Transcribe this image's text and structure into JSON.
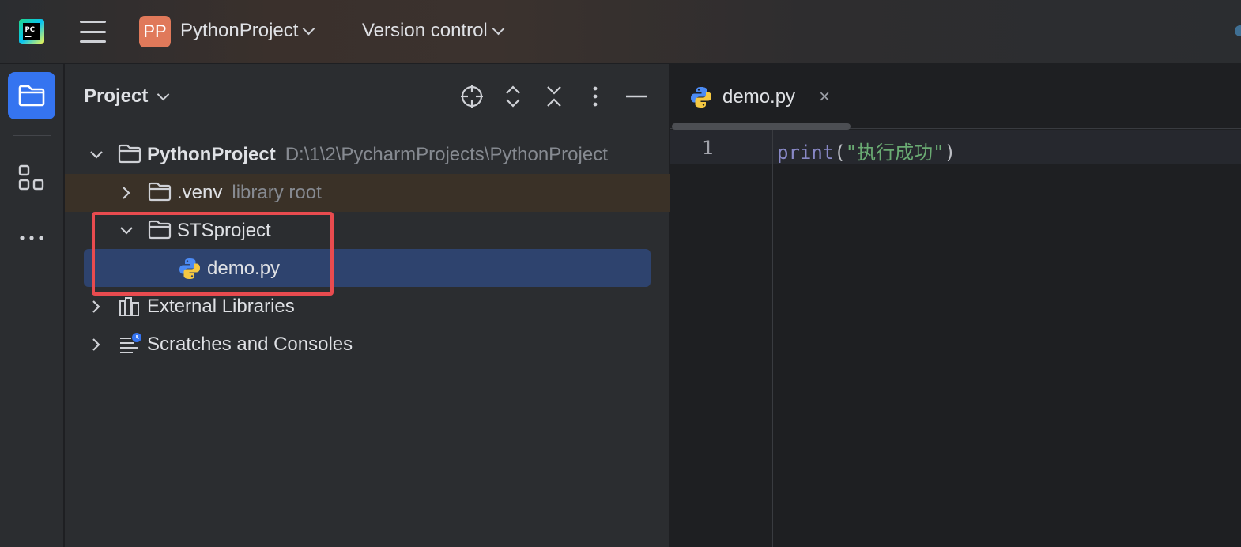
{
  "titlebar": {
    "project_badge": "PP",
    "project_name": "PythonProject",
    "vcs_label": "Version control",
    "icons": [
      "pycharm-logo-icon",
      "hamburger-menu-icon",
      "chevron-down-icon"
    ]
  },
  "toolstrip": {
    "items": [
      "folder-icon",
      "structure-icon",
      "more-icon"
    ]
  },
  "project_panel": {
    "title": "Project",
    "actions": [
      "locate-icon",
      "expand-all-icon",
      "collapse-all-icon",
      "options-icon",
      "hide-icon"
    ],
    "tree": {
      "root": {
        "label": "PythonProject",
        "path": "D:\\1\\2\\PycharmProjects\\PythonProject",
        "expanded": true
      },
      "venv": {
        "label": ".venv",
        "hint": "library root",
        "expanded": false
      },
      "sts": {
        "label": "STSproject",
        "expanded": true
      },
      "demo": {
        "label": "demo.py",
        "selected": true
      },
      "ext": {
        "label": "External Libraries",
        "expanded": false
      },
      "scratch": {
        "label": "Scratches and Consoles",
        "expanded": false
      }
    }
  },
  "editor": {
    "tab": {
      "label": "demo.py",
      "close": "×"
    },
    "lines": [
      {
        "number": "1",
        "kw": "print",
        "open": "(",
        "str": "\"执行成功\"",
        "close": ")"
      }
    ]
  },
  "colors": {
    "accent": "#3574f0",
    "selection": "#2e436e",
    "annotation_box": "#e84b4f",
    "badge": "#e0795a"
  }
}
